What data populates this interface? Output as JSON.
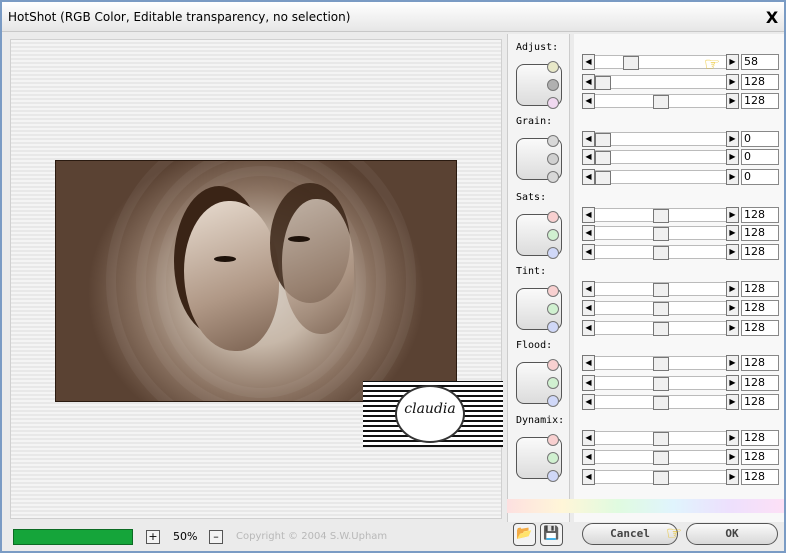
{
  "window": {
    "title": "HotShot (RGB Color, Editable transparency, no selection)",
    "close_label": "X"
  },
  "preview": {
    "watermark_text": "claudia"
  },
  "footer": {
    "zoom_in": "+",
    "zoom_level": "50%",
    "zoom_out": "–",
    "copyright": "Copyright © 2004 S.W.Upham",
    "progress": 1.0
  },
  "groups": [
    {
      "label": "Adjust:",
      "values": [
        "58",
        "128",
        "128"
      ],
      "positions": [
        0.24,
        0.0,
        0.5
      ]
    },
    {
      "label": "Grain:",
      "values": [
        "0",
        "0",
        "0"
      ],
      "positions": [
        0.0,
        0.0,
        0.0
      ]
    },
    {
      "label": "Sats:",
      "values": [
        "128",
        "128",
        "128"
      ],
      "positions": [
        0.5,
        0.5,
        0.5
      ]
    },
    {
      "label": "Tint:",
      "values": [
        "128",
        "128",
        "128"
      ],
      "positions": [
        0.5,
        0.5,
        0.5
      ]
    },
    {
      "label": "Flood:",
      "values": [
        "128",
        "128",
        "128"
      ],
      "positions": [
        0.5,
        0.5,
        0.5
      ]
    },
    {
      "label": "Dynamix:",
      "values": [
        "128",
        "128",
        "128"
      ],
      "positions": [
        0.5,
        0.5,
        0.5
      ]
    }
  ],
  "buttons": {
    "cancel": "Cancel",
    "ok": "OK"
  },
  "colors": {
    "progress": "#15a53a",
    "hand": "#e6b800"
  }
}
